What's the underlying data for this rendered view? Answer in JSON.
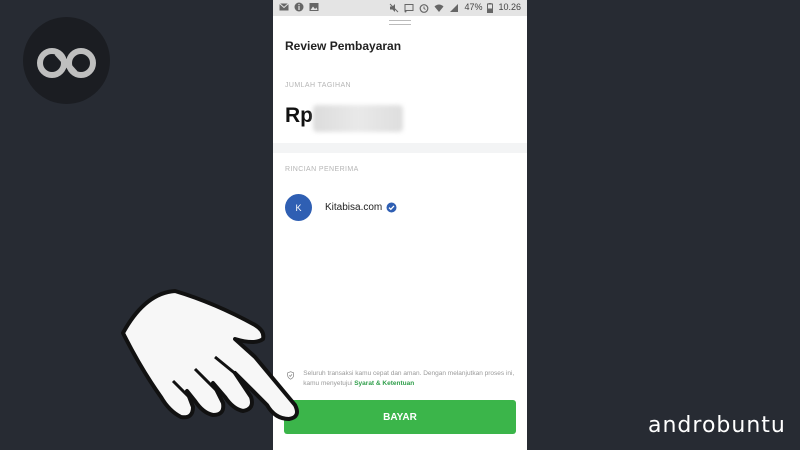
{
  "status_bar": {
    "battery": "47%",
    "time": "10.26",
    "icons": [
      "mail-icon",
      "info-icon",
      "image-icon",
      "mute-icon",
      "cast-icon",
      "alarm-icon",
      "wifi-icon",
      "signal-icon",
      "battery-icon"
    ]
  },
  "sheet": {
    "title": "Review Pembayaran",
    "amount_label": "JUMLAH TAGIHAN",
    "amount_prefix": "Rp",
    "recipient_label": "RINCIAN PENERIMA",
    "recipient": {
      "avatar_initial": "K",
      "name": "Kitabisa.com"
    },
    "consent_text": "Seluruh transaksi kamu cepat dan aman. Dengan melanjutkan proses ini, kamu menyetujui",
    "consent_link": "Syarat & Ketentuan",
    "pay_label": "BAYAR"
  },
  "watermark": "androbuntu",
  "colors": {
    "background": "#272b33",
    "pay_button": "#3bb54a",
    "avatar": "#2f5fb3",
    "verified": "#2f5fb3",
    "link": "#2f9e4a"
  }
}
